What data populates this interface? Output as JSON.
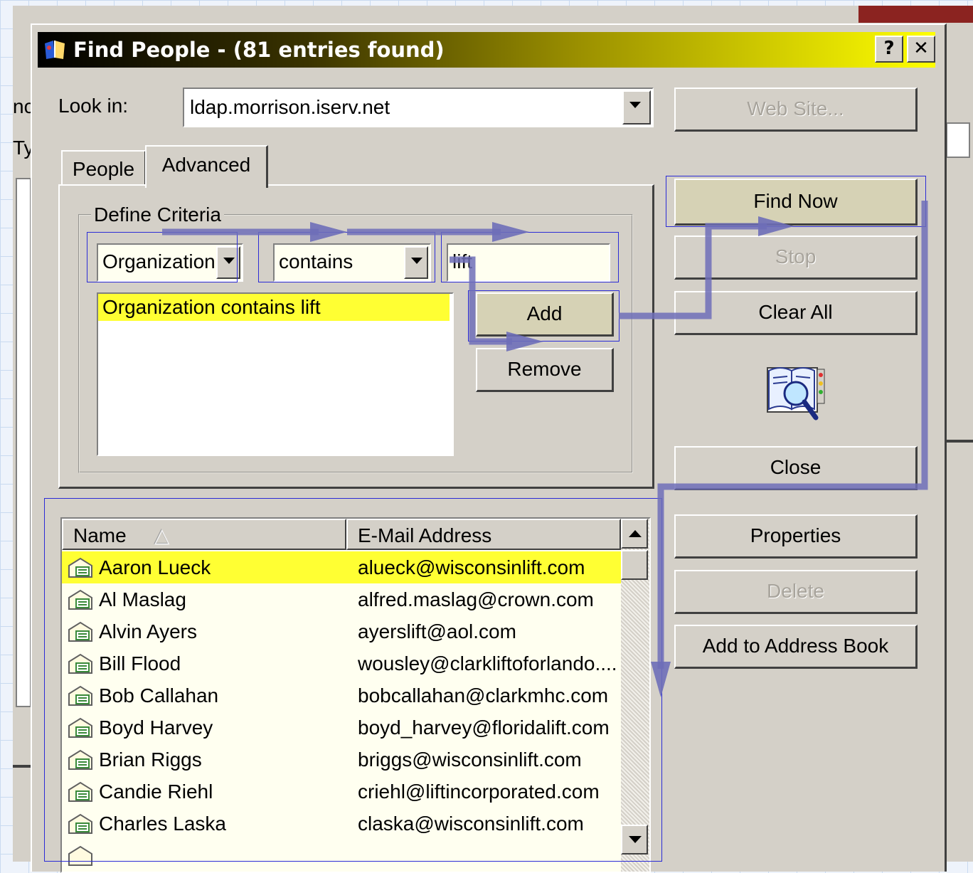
{
  "background": {
    "partial_label_1": "nc",
    "partial_label_2": "Ty"
  },
  "dialog": {
    "title": "Find People - (81 entries found)",
    "help_button": "?",
    "close_button": "✕",
    "look_in_label": "Look in:",
    "look_in_value": "ldap.morrison.iserv.net",
    "tabs": [
      {
        "label": "People"
      },
      {
        "label": "Advanced"
      }
    ],
    "criteria": {
      "group_label": "Define Criteria",
      "field_value": "Organization",
      "operator_value": "contains",
      "text_value": "lift",
      "list_items": [
        "Organization contains lift"
      ],
      "add_button": "Add",
      "remove_button": "Remove"
    },
    "buttons": {
      "web_site": "Web Site...",
      "find_now": "Find Now",
      "stop": "Stop",
      "clear_all": "Clear All",
      "close": "Close",
      "properties": "Properties",
      "delete": "Delete",
      "add_to_address_book": "Add to Address Book"
    },
    "results": {
      "columns": [
        "Name",
        "E-Mail Address"
      ],
      "sort_indicator": "△",
      "rows": [
        {
          "name": "Aaron Lueck",
          "email": "alueck@wisconsinlift.com"
        },
        {
          "name": "Al Maslag",
          "email": "alfred.maslag@crown.com"
        },
        {
          "name": "Alvin Ayers",
          "email": "ayerslift@aol.com"
        },
        {
          "name": "Bill Flood",
          "email": "wousley@clarkliftoforlando...."
        },
        {
          "name": "Bob Callahan",
          "email": "bobcallahan@clarkmhc.com"
        },
        {
          "name": "Boyd Harvey",
          "email": "boyd_harvey@floridalift.com"
        },
        {
          "name": "Brian Riggs",
          "email": "briggs@wisconsinlift.com"
        },
        {
          "name": "Candie Riehl",
          "email": "criehl@liftincorporated.com"
        },
        {
          "name": "Charles Laska",
          "email": "claska@wisconsinlift.com"
        }
      ]
    }
  },
  "colors": {
    "selection": "#ffff33",
    "annotation": "#6e6eb8",
    "highlight_box": "#2b2bd6"
  }
}
